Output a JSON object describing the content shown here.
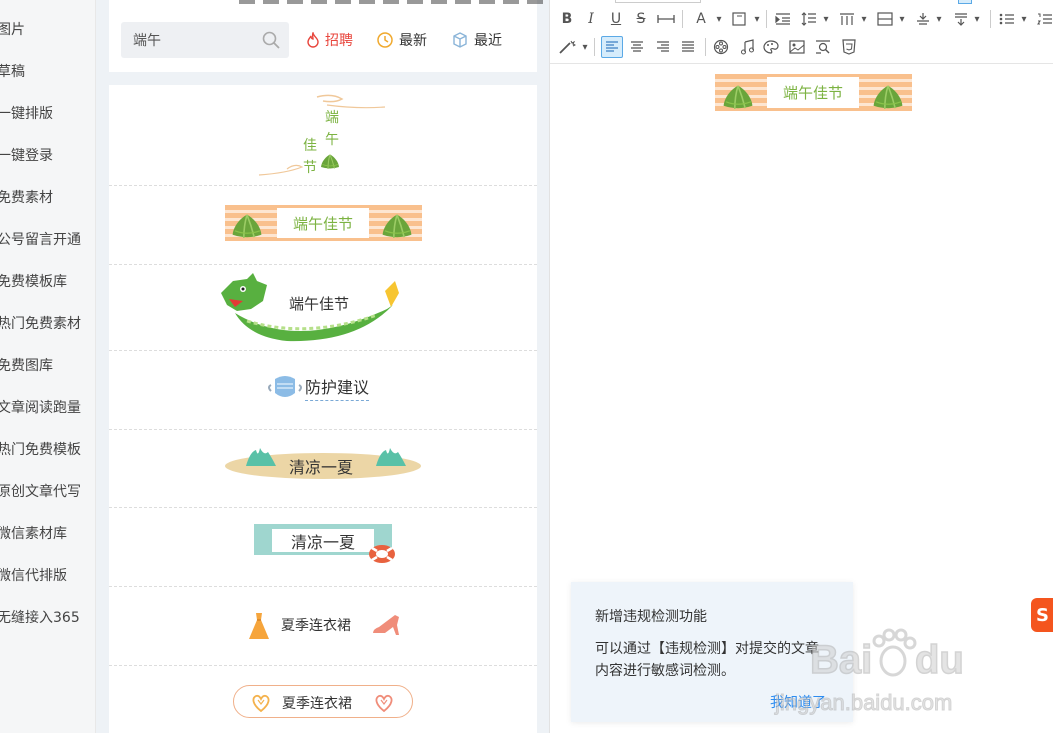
{
  "nav": {
    "items": [
      "图片",
      "草稿",
      "一键排版",
      "一键登录",
      "免费素材",
      "公号留言开通",
      "免费模板库",
      "热门免费素材",
      "免费图库",
      "文章阅读跑量",
      "热门免费模板",
      "原创文章代写",
      "微信素材库",
      "微信代排版",
      "无缝接入365"
    ]
  },
  "search": {
    "value": "端午",
    "filters": [
      {
        "label": "招聘",
        "color": "#e8463d"
      },
      {
        "label": "最新",
        "color": "#333333"
      },
      {
        "label": "最近",
        "color": "#333333"
      }
    ]
  },
  "materials": {
    "item1": {
      "chars": [
        "端",
        "午",
        "佳",
        "节"
      ]
    },
    "item2": {
      "title": "端午佳节"
    },
    "item3": {
      "title": "端午佳节"
    },
    "item4": {
      "title": "防护建议"
    },
    "item5": {
      "title": "清凉一夏"
    },
    "item6": {
      "title": "清凉一夏"
    },
    "item7": {
      "title": "夏季连衣裙"
    },
    "item8": {
      "title": "夏季连衣裙"
    }
  },
  "editor": {
    "toolbar": {
      "bold": "B",
      "italic": "I",
      "underline": "U",
      "strike": "S",
      "fontcolor": "A"
    },
    "content": {
      "banner": "端午佳节"
    }
  },
  "notice": {
    "title": "新增违规检测功能",
    "body": "可以通过【违规检测】对提交的文章内容进行敏感词检测。",
    "button": "我知道了"
  },
  "colors": {
    "accent": "#2d8cf0",
    "zongzi_green": "#7cb342",
    "stripe_orange": "#f9c08d",
    "hot_red": "#e8463d"
  }
}
